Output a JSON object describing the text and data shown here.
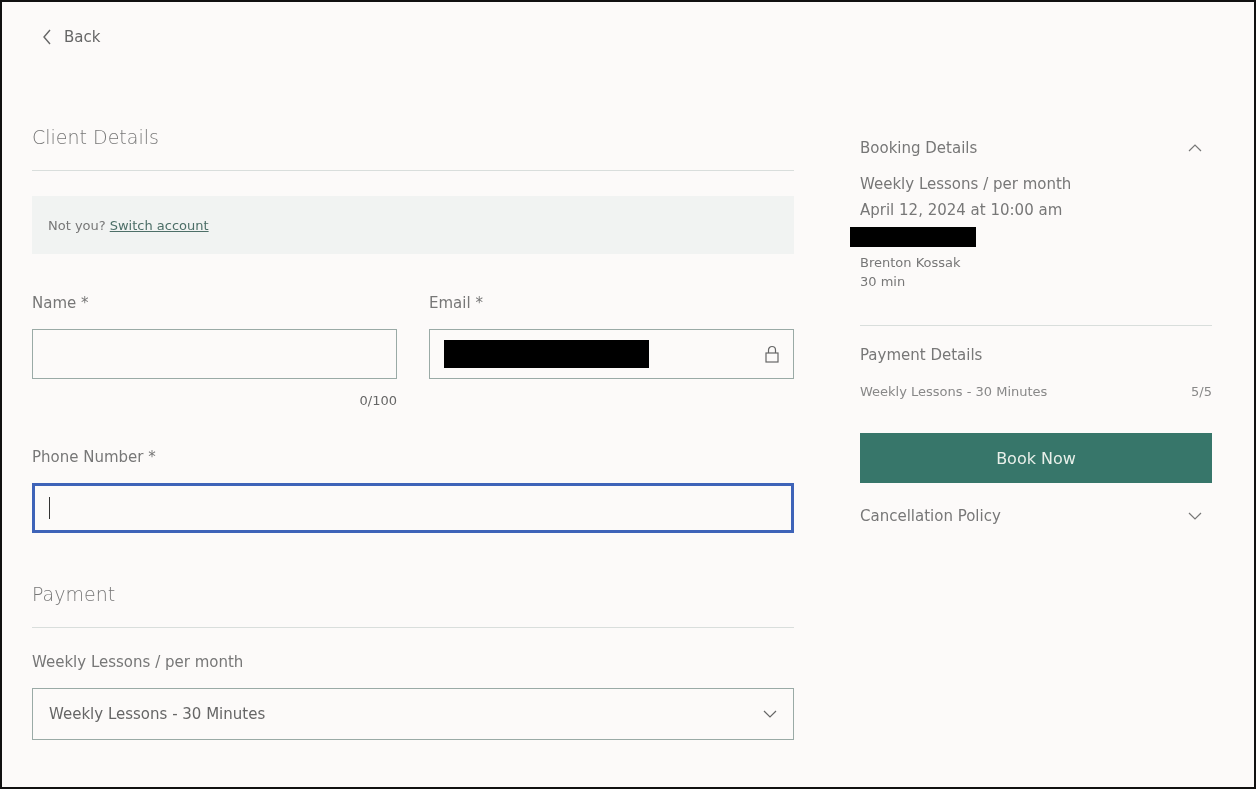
{
  "back_link": {
    "label": "Back"
  },
  "client_details": {
    "title": "Client Details",
    "notice": {
      "text": "Not you?",
      "link": "Switch account"
    },
    "fields": [
      {
        "label": "Name *",
        "counter": "0/100",
        "locked": false,
        "focused": false,
        "redacted": false
      },
      {
        "label": "Email *",
        "locked": true,
        "focused": false,
        "redacted": true
      },
      {
        "label": "Phone Number *",
        "locked": false,
        "focused": true,
        "redacted": false
      }
    ]
  },
  "payment": {
    "title": "Payment",
    "select": {
      "label": "Weekly Lessons / per month",
      "value": "Weekly Lessons - 30 Minutes"
    }
  },
  "booking_details": {
    "title": "Booking Details",
    "expanded": true,
    "service": "Weekly Lessons / per month",
    "datetime": "April 12, 2024 at 10:00 am",
    "redacted_line": true,
    "staff": "Brenton Kossak",
    "duration": "30 min"
  },
  "payment_details": {
    "title": "Payment Details",
    "item": "Weekly Lessons - 30 Minutes",
    "count": "5/5"
  },
  "book_button": {
    "label": "Book Now"
  },
  "cancellation_policy": {
    "title": "Cancellation Policy",
    "expanded": false
  }
}
